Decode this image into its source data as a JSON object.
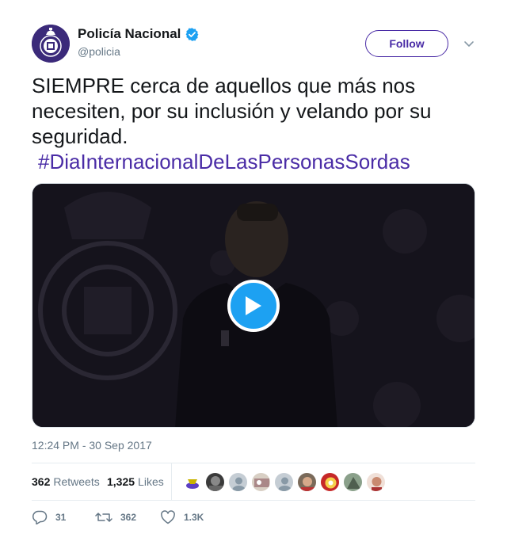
{
  "account": {
    "display_name": "Policía Nacional",
    "handle": "@policia",
    "verified": true
  },
  "follow_button": {
    "label": "Follow"
  },
  "tweet": {
    "text": "SIEMPRE cerca de aquellos que más nos necesiten, por su inclusión y velando por su seguridad.",
    "hashtag": "#DiaInternacionalDeLasPersonasSordas",
    "timestamp": "12:24 PM - 30 Sep 2017"
  },
  "media": {
    "type": "video",
    "play_icon": "play-icon"
  },
  "stats": {
    "retweets_count": "362",
    "retweets_label": "Retweets",
    "likes_count": "1,325",
    "likes_label": "Likes"
  },
  "actions": {
    "reply_count": "31",
    "retweet_count": "362",
    "like_count": "1.3K"
  },
  "colors": {
    "accent": "#4a2ca6",
    "verified": "#1da1f2",
    "play": "#1da1f2",
    "muted": "#657786"
  }
}
